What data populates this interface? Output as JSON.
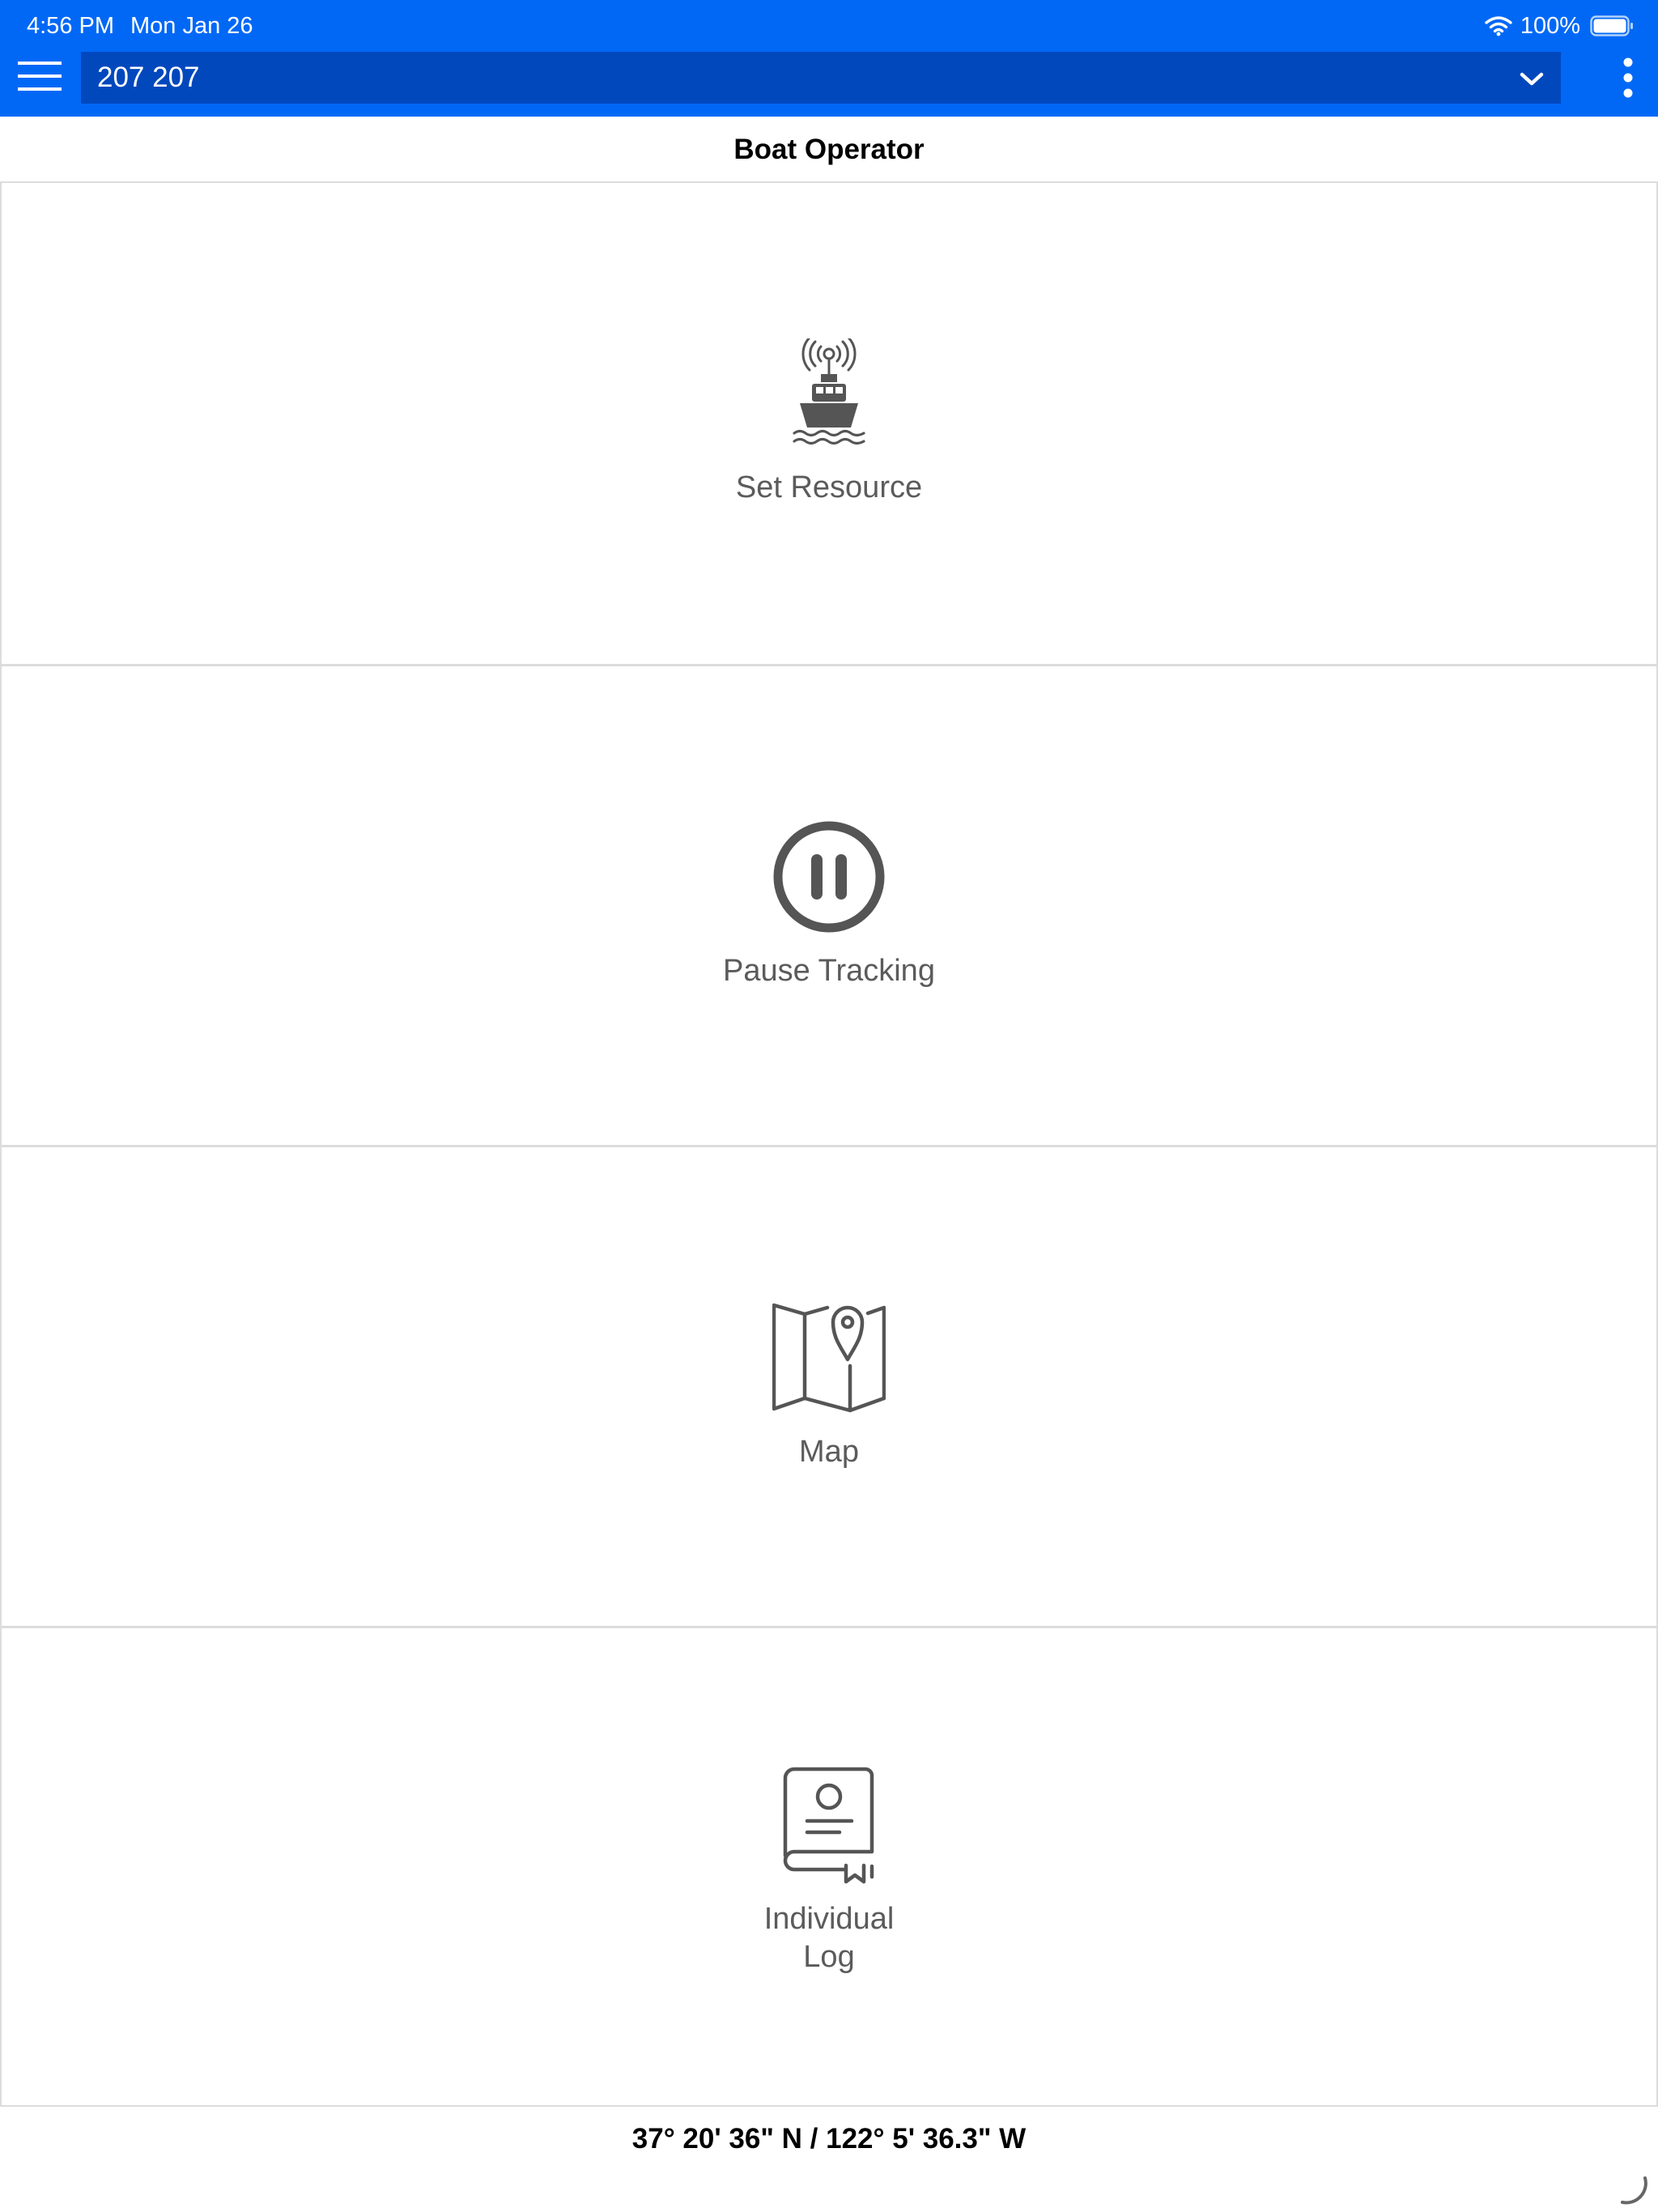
{
  "status_bar": {
    "time": "4:56 PM",
    "date": "Mon Jan 26",
    "battery_percent": "100%"
  },
  "toolbar": {
    "selected_resource": "207 207"
  },
  "page": {
    "title": "Boat Operator"
  },
  "tiles": [
    {
      "label": "Set Resource",
      "icon": "boat-radio-icon"
    },
    {
      "label": "Pause Tracking",
      "icon": "pause-circle-icon"
    },
    {
      "label": "Map",
      "icon": "map-pin-icon"
    },
    {
      "label": "Individual\nLog",
      "icon": "log-book-icon"
    }
  ],
  "footer": {
    "coordinates": "37° 20' 36\" N / 122° 5' 36.3\" W"
  },
  "colors": {
    "header_blue": "#0168f6",
    "selector_blue": "#0148bd",
    "icon_gray": "#555555",
    "divider": "#dcdcdc"
  }
}
